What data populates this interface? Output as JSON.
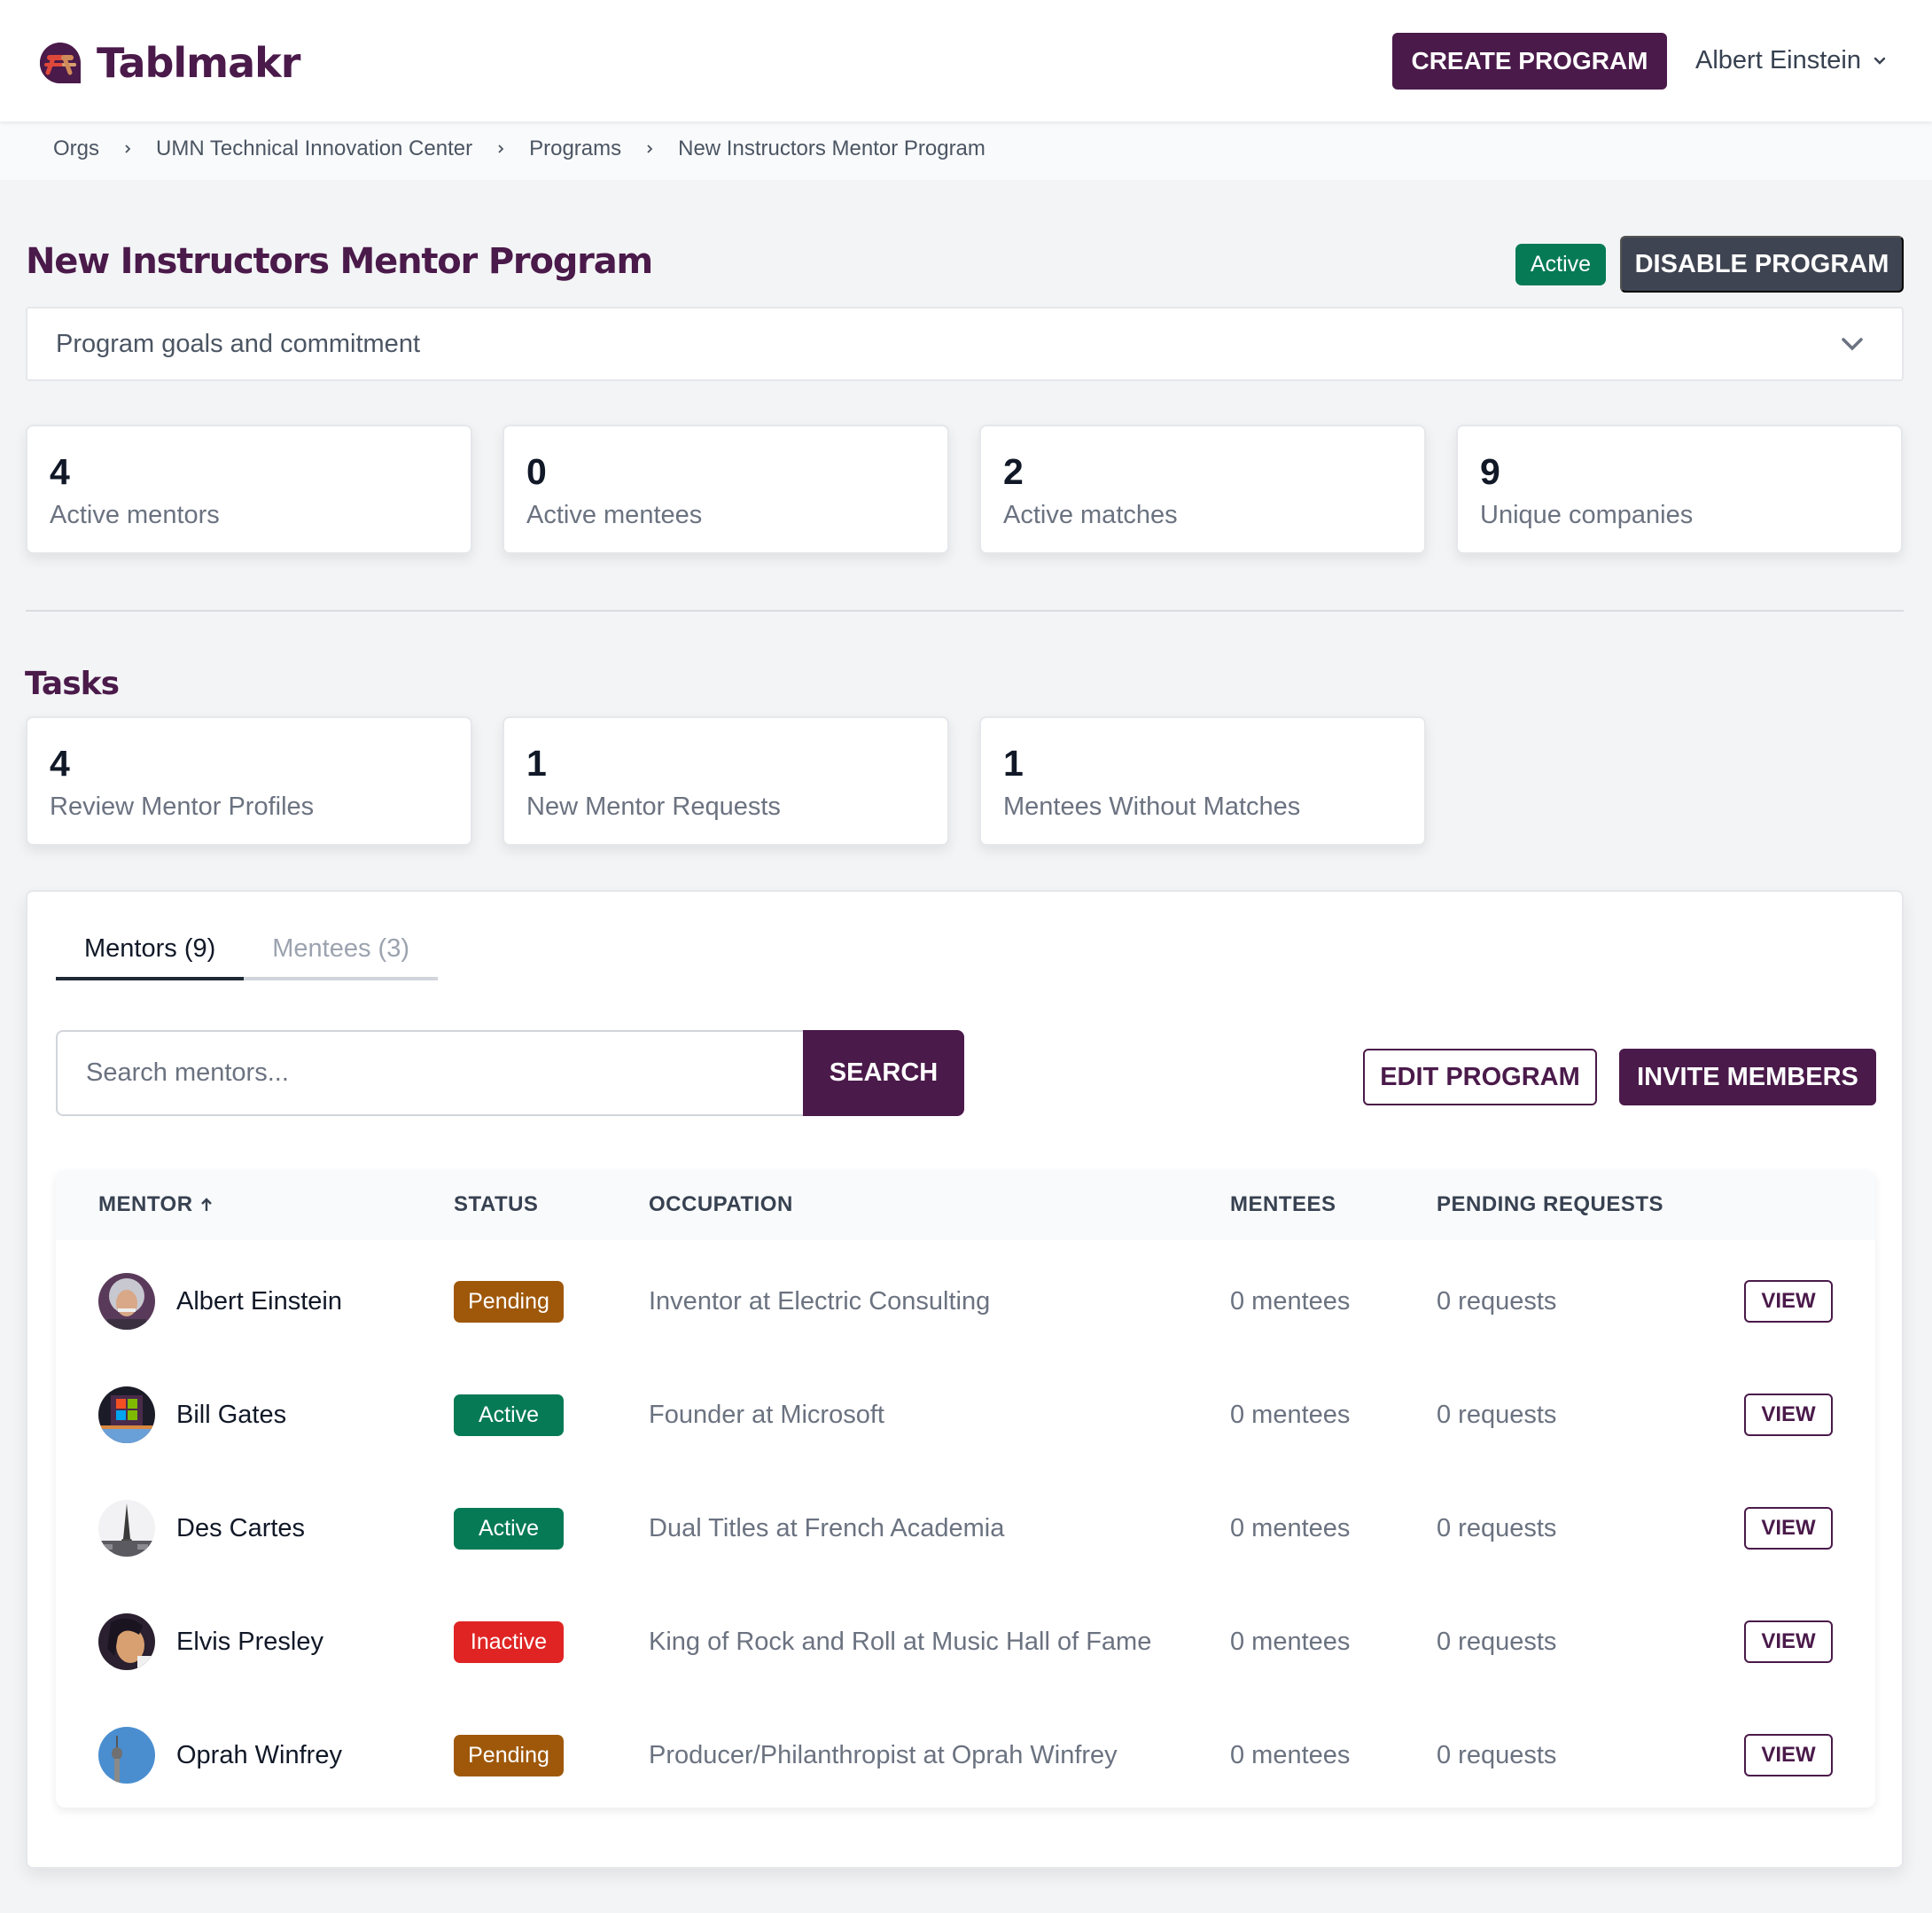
{
  "header": {
    "app_name": "Tablmakr",
    "create_button": "CREATE PROGRAM",
    "user_name": "Albert Einstein"
  },
  "breadcrumb": [
    "Orgs",
    "UMN Technical Innovation Center",
    "Programs",
    "New Instructors Mentor Program"
  ],
  "program": {
    "title": "New Instructors Mentor Program",
    "status": "Active",
    "disable_button": "DISABLE PROGRAM",
    "accordion_label": "Program goals and commitment"
  },
  "stats": [
    {
      "value": "4",
      "label": "Active mentors"
    },
    {
      "value": "0",
      "label": "Active mentees"
    },
    {
      "value": "2",
      "label": "Active matches"
    },
    {
      "value": "9",
      "label": "Unique companies"
    }
  ],
  "tasks": {
    "title": "Tasks",
    "items": [
      {
        "value": "4",
        "label": "Review Mentor Profiles"
      },
      {
        "value": "1",
        "label": "New Mentor Requests"
      },
      {
        "value": "1",
        "label": "Mentees Without Matches"
      }
    ]
  },
  "tabs": [
    {
      "label": "Mentors (9)",
      "active": true
    },
    {
      "label": "Mentees (3)",
      "active": false
    }
  ],
  "search": {
    "placeholder": "Search mentors...",
    "value": "",
    "button": "SEARCH"
  },
  "actions": {
    "edit": "EDIT PROGRAM",
    "invite": "INVITE MEMBERS"
  },
  "table": {
    "columns": [
      "MENTOR",
      "STATUS",
      "OCCUPATION",
      "MENTEES",
      "PENDING REQUESTS"
    ],
    "sort": {
      "column": "MENTOR",
      "direction": "ascending",
      "icon": "arrow-up-icon"
    },
    "view_label": "VIEW",
    "rows": [
      {
        "name": "Albert Einstein",
        "status": "Pending",
        "occupation": "Inventor at Electric Consulting",
        "mentees": "0 mentees",
        "requests": "0 requests",
        "avatar": "einstein-portrait"
      },
      {
        "name": "Bill Gates",
        "status": "Active",
        "occupation": "Founder at Microsoft",
        "mentees": "0 mentees",
        "requests": "0 requests",
        "avatar": "microsoft-booth"
      },
      {
        "name": "Des Cartes",
        "status": "Active",
        "occupation": "Dual Titles at French Academia",
        "mentees": "0 mentees",
        "requests": "0 requests",
        "avatar": "eiffel-tower"
      },
      {
        "name": "Elvis Presley",
        "status": "Inactive",
        "occupation": "King of Rock and Roll at Music Hall of Fame",
        "mentees": "0 mentees",
        "requests": "0 requests",
        "avatar": "elvis-portrait"
      },
      {
        "name": "Oprah Winfrey",
        "status": "Pending",
        "occupation": "Producer/Philanthropist at Oprah Winfrey",
        "mentees": "0 mentees",
        "requests": "0 requests",
        "avatar": "tv-tower"
      }
    ]
  },
  "colors": {
    "brand": "#4a1a4a",
    "active": "#057a55",
    "pending": "#9f580a",
    "inactive": "#e02424",
    "dark_button": "#3f4452"
  }
}
